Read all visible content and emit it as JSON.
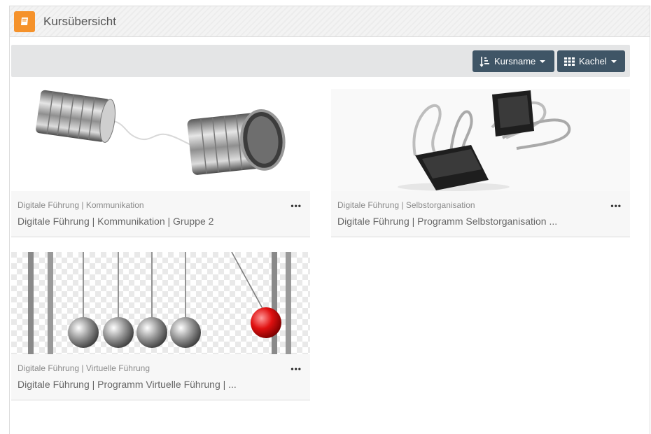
{
  "header": {
    "title": "Kursübersicht",
    "icon": "book-icon",
    "accent": "#f5922b"
  },
  "toolbar": {
    "sort_label": "Kursname",
    "sort_icon": "sort-ascending-icon",
    "view_label": "Kachel",
    "view_icon": "grid-icon",
    "button_color": "#3f5566"
  },
  "courses": [
    {
      "category": "Digitale Führung | Kommunikation",
      "name": "Digitale Führung | Kommunikation | Gruppe 2",
      "image": "tin-can-telephone-image",
      "menu": "•••"
    },
    {
      "category": "Digitale Führung | Selbstorganisation",
      "name": "Digitale Führung | Programm Selbstorganisation ...",
      "image": "binder-clips-image",
      "menu": "•••"
    },
    {
      "category": "Digitale Führung | Virtuelle Führung",
      "name": "Digitale Führung | Programm Virtuelle Führung | ...",
      "image": "newtons-cradle-image",
      "menu": "•••"
    }
  ]
}
